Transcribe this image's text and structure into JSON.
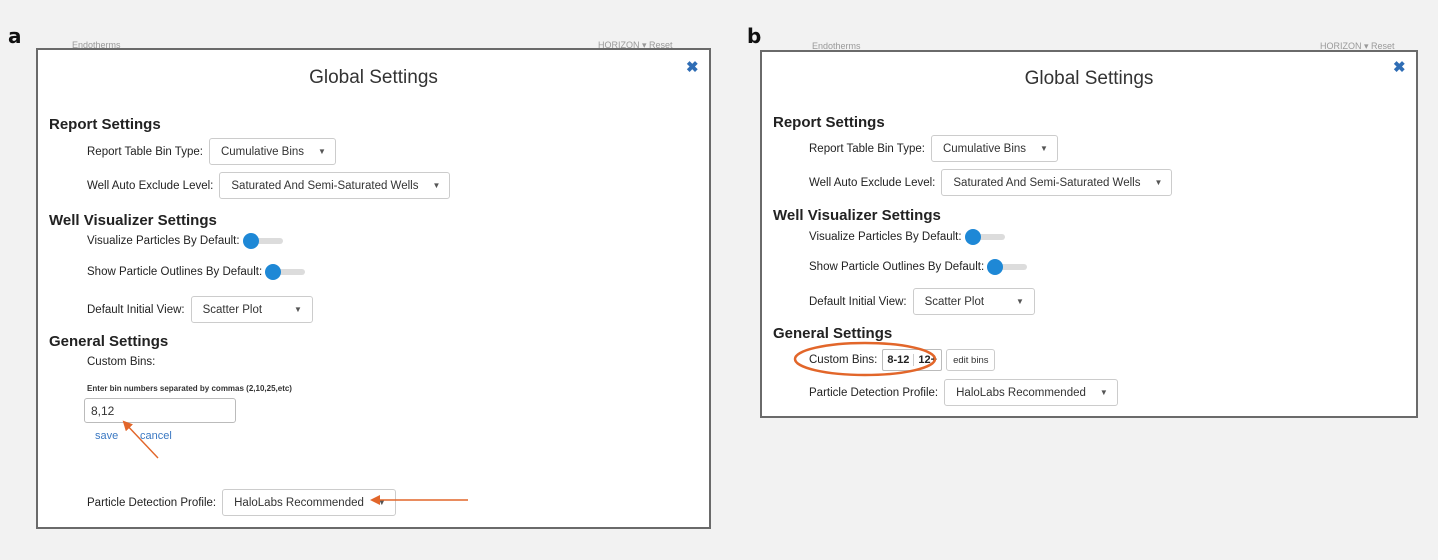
{
  "panels": {
    "a": {
      "letter": "a",
      "bleed_left": "Endotherms",
      "bleed_right": "HORIZON ▾ Reset",
      "title": "Global Settings",
      "close": "✖",
      "report_settings": {
        "heading": "Report Settings",
        "bin_type_label": "Report Table Bin Type:",
        "bin_type_value": "Cumulative Bins",
        "exclude_label": "Well Auto Exclude Level:",
        "exclude_value": "Saturated And Semi-Saturated Wells"
      },
      "visualizer_settings": {
        "heading": "Well Visualizer Settings",
        "visualize_label": "Visualize Particles By Default:",
        "outlines_label": "Show Particle Outlines By Default:",
        "view_label": "Default Initial View:",
        "view_value": "Scatter Plot"
      },
      "general_settings": {
        "heading": "General Settings",
        "custom_bins_label": "Custom Bins:",
        "hint": "Enter bin numbers separated by commas (2,10,25,etc)",
        "bins_value": "8,12",
        "save": "save",
        "cancel": "cancel",
        "profile_label": "Particle Detection Profile:",
        "profile_value": "HaloLabs Recommended"
      }
    },
    "b": {
      "letter": "b",
      "bleed_left": "Endotherms",
      "bleed_right": "HORIZON ▾ Reset",
      "title": "Global Settings",
      "close": "✖",
      "report_settings": {
        "heading": "Report Settings",
        "bin_type_label": "Report Table Bin Type:",
        "bin_type_value": "Cumulative Bins",
        "exclude_label": "Well Auto Exclude Level:",
        "exclude_value": "Saturated And Semi-Saturated Wells"
      },
      "visualizer_settings": {
        "heading": "Well Visualizer Settings",
        "visualize_label": "Visualize Particles By Default:",
        "outlines_label": "Show Particle Outlines By Default:",
        "view_label": "Default Initial View:",
        "view_value": "Scatter Plot"
      },
      "general_settings": {
        "heading": "General Settings",
        "custom_bins_label": "Custom Bins:",
        "bins": [
          "8-12",
          "12+"
        ],
        "edit_bins": "edit bins",
        "profile_label": "Particle Detection Profile:",
        "profile_value": "HaloLabs Recommended"
      }
    }
  },
  "colors": {
    "annotation": "#e2662a",
    "toggle": "#1e88d6",
    "link": "#3a78c2"
  },
  "icons": {
    "close": "close-icon",
    "caret": "caret-down-icon"
  }
}
